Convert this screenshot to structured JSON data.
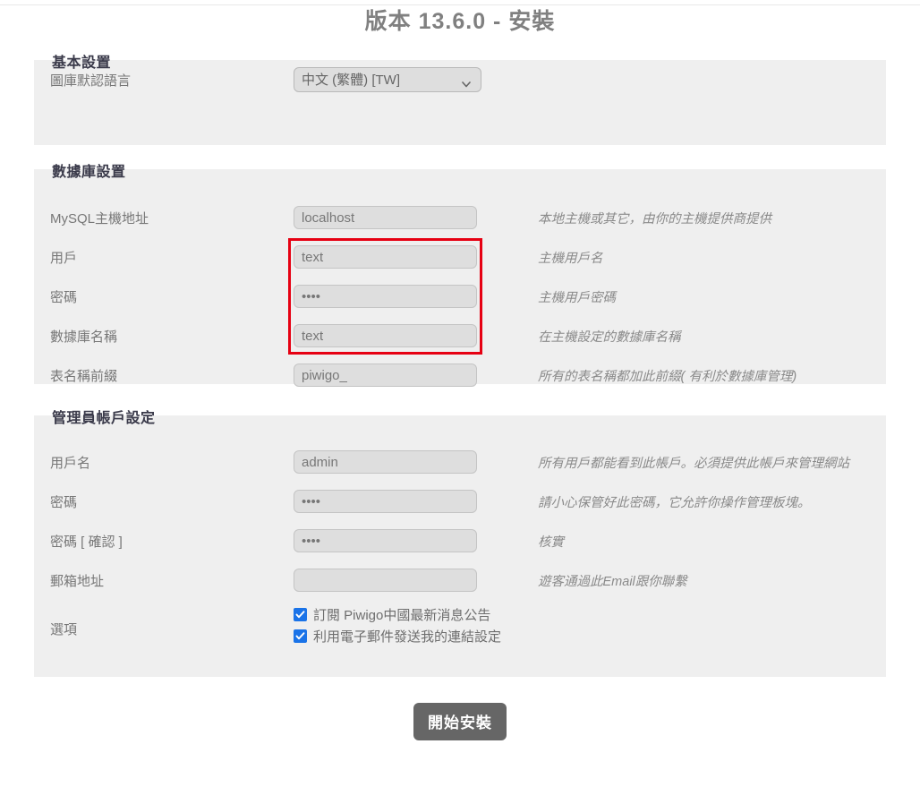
{
  "page": {
    "title": "版本 13.6.0 - 安裝"
  },
  "basic": {
    "legend": "基本設置",
    "language_label": "圖庫默認語言",
    "language_value": "中文 (繁體) [TW]",
    "language_options": [
      "中文 (繁體) [TW]"
    ],
    "dropdown_icon": "chevron-down-icon"
  },
  "database": {
    "legend": "數據庫設置",
    "highlight_color": "#e60012",
    "rows": [
      {
        "label": "MySQL主機地址",
        "value": "localhost",
        "placeholder": "localhost",
        "hint": "本地主機或其它，由你的主機提供商提供",
        "type": "text",
        "highlighted": false
      },
      {
        "label": "用戶",
        "value": "text",
        "placeholder": "",
        "hint": "主機用戶名",
        "type": "text",
        "highlighted": true
      },
      {
        "label": "密碼",
        "value": "••••",
        "placeholder": "",
        "hint": "主機用戶密碼",
        "type": "password",
        "highlighted": true
      },
      {
        "label": "數據庫名稱",
        "value": "text",
        "placeholder": "",
        "hint": "在主機設定的數據庫名稱",
        "type": "text",
        "highlighted": true
      },
      {
        "label": "表名稱前綴",
        "value": "piwigo_",
        "placeholder": "piwigo_",
        "hint": "所有的表名稱都加此前綴( 有利於數據庫管理)",
        "type": "text",
        "highlighted": false
      }
    ]
  },
  "admin": {
    "legend": "管理員帳戶設定",
    "rows": [
      {
        "label": "用戶名",
        "value": "admin",
        "placeholder": "admin",
        "hint": "所有用戶都能看到此帳戶。必須提供此帳戶來管理網站",
        "type": "text"
      },
      {
        "label": "密碼",
        "value": "••••",
        "placeholder": "",
        "hint": "請小心保管好此密碼，它允許你操作管理板塊。",
        "type": "password"
      },
      {
        "label": "密碼 [ 確認 ]",
        "value": "••••",
        "placeholder": "",
        "hint": "核實",
        "type": "password"
      },
      {
        "label": "郵箱地址",
        "value": "",
        "placeholder": "",
        "hint": "遊客通過此Email跟你聯繫",
        "type": "text"
      }
    ],
    "options_label": "選項",
    "options": [
      {
        "label": "訂閱 Piwigo中國最新消息公告",
        "checked": true
      },
      {
        "label": "利用電子郵件發送我的連結設定",
        "checked": true
      }
    ]
  },
  "footer": {
    "submit_label": "開始安裝"
  }
}
